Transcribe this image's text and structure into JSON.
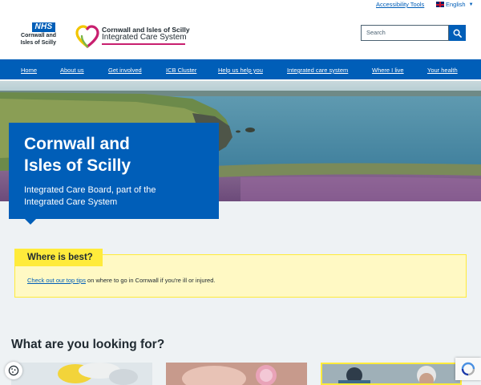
{
  "utility": {
    "accessibility_label": "Accessibility Tools",
    "language_label": "English"
  },
  "header": {
    "nhs_logo_text": "NHS",
    "nhs_org_line1": "Cornwall and",
    "nhs_org_line2": "Isles of Scilly",
    "ics_line1": "Cornwall and Isles of Scilly",
    "ics_line2": "Integrated Care System",
    "search_placeholder": "Search"
  },
  "nav": {
    "items": [
      {
        "label": "Home"
      },
      {
        "label": "About us"
      },
      {
        "label": "Get involved"
      },
      {
        "label": "ICB Cluster"
      },
      {
        "label": "Help us help you"
      },
      {
        "label": "Integrated care system"
      },
      {
        "label": "Where I live"
      },
      {
        "label": "Your health"
      }
    ]
  },
  "hero": {
    "title_line1": "Cornwall and",
    "title_line2": "Isles of Scilly",
    "subtitle_line1": "Integrated Care Board, part of the",
    "subtitle_line2": "Integrated Care System"
  },
  "callout": {
    "tag": "Where is best?",
    "link_text": "Check out our top tips",
    "body_text": " on where to go in Cornwall if you're ill or injured."
  },
  "looking": {
    "heading": "What are you looking for?"
  },
  "colors": {
    "nhs_blue": "#005eb8",
    "callout_yellow": "#ffeb3b",
    "callout_bg": "#fff9c4",
    "ics_magenta": "#c81f6f"
  }
}
